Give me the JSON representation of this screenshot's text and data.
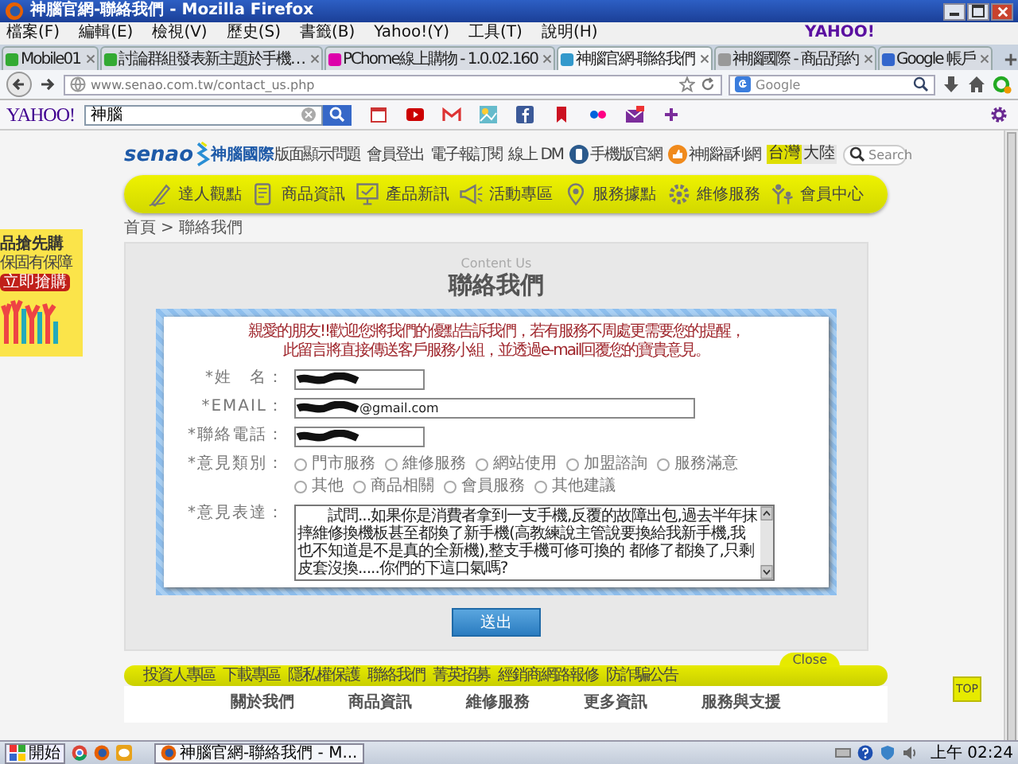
{
  "window": {
    "title": "神腦官網-聯絡我們 - Mozilla Firefox"
  },
  "menu": [
    "檔案(F)",
    "編輯(E)",
    "檢視(V)",
    "歷史(S)",
    "書籤(B)",
    "Yahoo!(Y)",
    "工具(T)",
    "說明(H)"
  ],
  "tabs": [
    {
      "label": "Mobile01",
      "selected": false
    },
    {
      "label": "討論群組發表新主題於手機…",
      "selected": false
    },
    {
      "label": "PChome線上購物 - 1.0.02.160",
      "selected": false
    },
    {
      "label": "神腦官網-聯絡我們",
      "selected": true
    },
    {
      "label": "神腦國際 - 商品預約",
      "selected": false
    },
    {
      "label": "Google 帳戶",
      "selected": false
    }
  ],
  "tab_bar_logo": "YAHOO!",
  "address_bar": {
    "url": "www.senao.com.tw/contact_us.php"
  },
  "search_bar": {
    "placeholder": "Google"
  },
  "yahoo_toolbar": {
    "logo": "YAHOO!",
    "search_value": "神腦"
  },
  "site": {
    "logo_text": "senao",
    "logo_cn": "神腦國際",
    "top_links": [
      "版面顯示問題",
      "會員登出",
      "電子報訂閱",
      "線上 DM"
    ],
    "app_links": [
      "手機版官網",
      "神腦福利網"
    ],
    "regions": [
      {
        "label": "台灣",
        "selected": true
      },
      {
        "label": "大陸",
        "selected": false
      }
    ],
    "search_placeholder": "Search",
    "nav": [
      "達人觀點",
      "商品資訊",
      "產品新訊",
      "活動專區",
      "服務據點",
      "維修服務",
      "會員中心"
    ]
  },
  "breadcrumb": [
    "首頁",
    ">",
    "聯絡我們"
  ],
  "side_ad": {
    "title": "品搶先購",
    "subtitle": "保固有保障",
    "button": "立即搶購"
  },
  "contact": {
    "subtitle": "Content Us",
    "title": "聯絡我們",
    "notice": [
      "親愛的朋友!!歡迎您將我們的優點告訴我們，若有服務不周處更需要您的提醒，",
      "此留言將直接傳送客戶服務小組，並透過e-mail回覆您的寶貴意見。"
    ],
    "fields": [
      {
        "kind": "text",
        "label": "*姓　名：",
        "wide": false,
        "redacted": true
      },
      {
        "kind": "text",
        "label": "*EMAIL：",
        "wide": true,
        "redacted": true,
        "value": "@gmail.com"
      },
      {
        "kind": "text",
        "label": "*聯絡電話：",
        "wide": false,
        "redacted": true
      },
      {
        "kind": "radio",
        "label": "*意見類別：",
        "options": [
          {
            "label": "門市服務",
            "selected": false
          },
          {
            "label": "維修服務",
            "selected": false
          },
          {
            "label": "網站使用",
            "selected": false
          },
          {
            "label": "加盟諮詢",
            "selected": false
          },
          {
            "label": "服務滿意",
            "selected": false
          },
          {
            "label": "其他",
            "selected": false
          },
          {
            "label": "商品相關",
            "selected": false
          },
          {
            "label": "會員服務",
            "selected": false
          },
          {
            "label": "其他建議",
            "selected": false
          }
        ]
      },
      {
        "kind": "textarea",
        "label": "*意見表達：",
        "value": "　　試問...如果你是消費者拿到一支手機,反覆的故障出包,過去半年抹摔維修換機板甚至都換了新手機(高教練說主管說要換給我新手機,我也不知道是不是真的全新機),整支手機可修可換的 都修了都換了,只剩皮套沒換.....你們的下這口氣嗎?"
      }
    ],
    "submit": "送出"
  },
  "footer": {
    "links": [
      "投資人專區",
      "下載專區",
      "隱私權保護",
      "聯絡我們",
      "菁英招募",
      "經銷商網路報修",
      "防詐騙公告"
    ],
    "close": "Close",
    "columns": [
      "關於我們",
      "商品資訊",
      "維修服務",
      "更多資訊",
      "服務與支援"
    ]
  },
  "top_button": "TOP",
  "taskbar": {
    "start": "開始",
    "task": "神腦官網-聯絡我們 - M...",
    "clock": "上午 02:24"
  }
}
